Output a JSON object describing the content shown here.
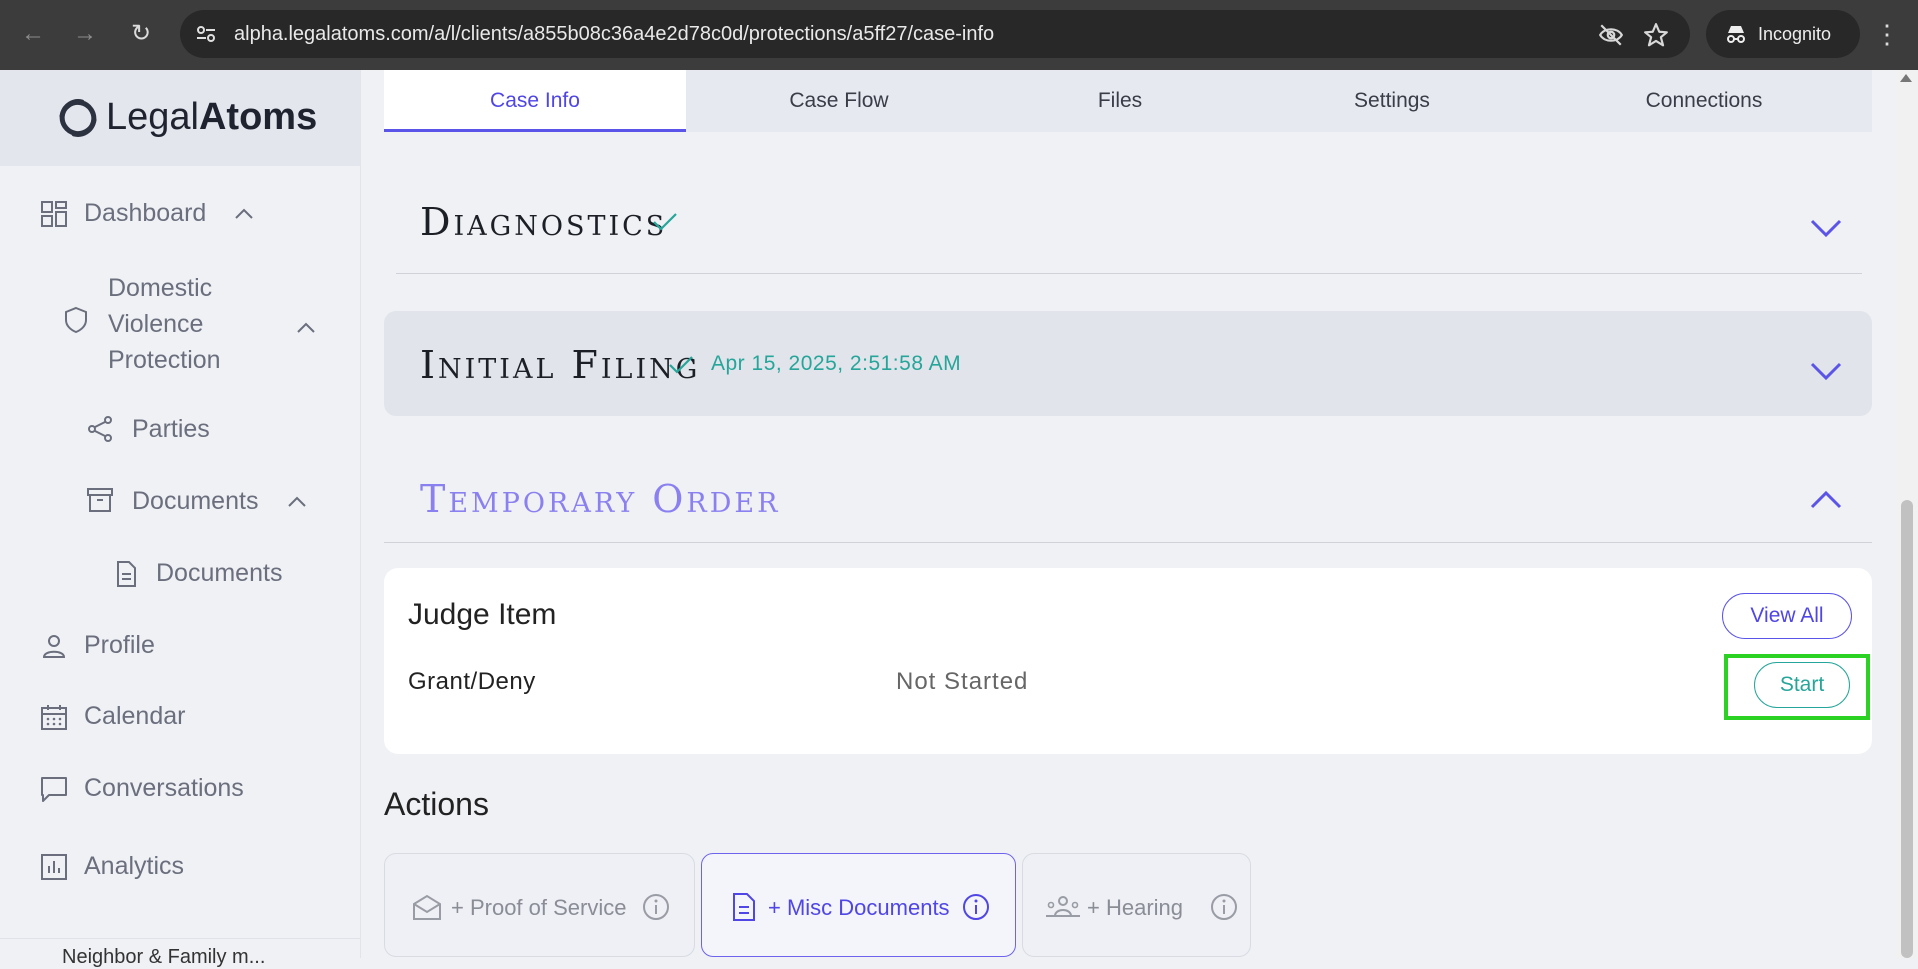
{
  "browser": {
    "url": "alpha.legalatoms.com/a/l/clients/a855b08c36a4e2d78c0d/protections/a5ff27/case-info",
    "incognito_label": "Incognito"
  },
  "sidebar": {
    "logo": {
      "light": "Legal",
      "bold": "Atoms"
    },
    "dashboard": "Dashboard",
    "case_line1": "Domestic",
    "case_line2": "Violence",
    "case_line3": "Protection",
    "parties": "Parties",
    "documents_group": "Documents",
    "documents_item": "Documents",
    "profile": "Profile",
    "calendar": "Calendar",
    "conversations": "Conversations",
    "analytics": "Analytics",
    "cut_text": "Neighbor & Family m..."
  },
  "tabs": [
    "Case Info",
    "Case Flow",
    "Files",
    "Settings",
    "Connections"
  ],
  "sections": {
    "diagnostics": {
      "title": "Diagnostics"
    },
    "initial_filing": {
      "title": "Initial Filing",
      "timestamp": "Apr 15, 2025, 2:51:58 AM"
    },
    "temporary_order": {
      "title": "Temporary Order"
    }
  },
  "judge_panel": {
    "title": "Judge Item",
    "view_all": "View All",
    "item_label": "Grant/Deny",
    "item_status": "Not Started",
    "start": "Start"
  },
  "actions": {
    "title": "Actions",
    "proof_of_service": "+ Proof of Service",
    "misc_documents": "+ Misc Documents",
    "hearing": "+ Hearing"
  },
  "colors": {
    "accent": "#4f46e5",
    "teal": "#26a69a",
    "highlight": "#2bd123"
  }
}
